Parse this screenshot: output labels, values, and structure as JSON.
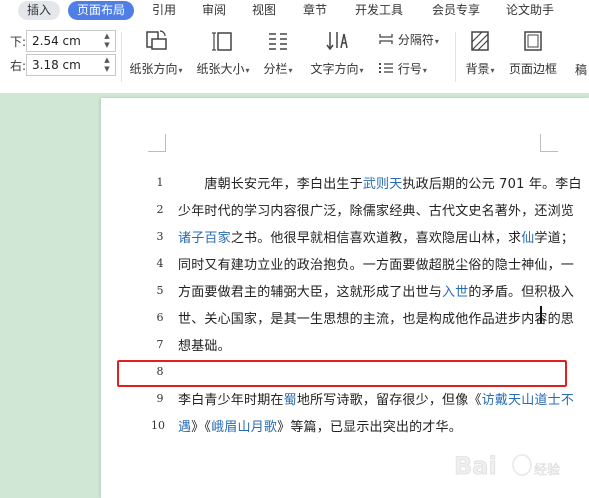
{
  "ribbon": {
    "tabs": [
      {
        "label": "插入",
        "state": "pill"
      },
      {
        "label": "页面布局",
        "state": "active"
      },
      {
        "label": "引用",
        "state": ""
      },
      {
        "label": "审阅",
        "state": ""
      },
      {
        "label": "视图",
        "state": ""
      },
      {
        "label": "章节",
        "state": ""
      },
      {
        "label": "开发工具",
        "state": ""
      },
      {
        "label": "会员专享",
        "state": ""
      },
      {
        "label": "论文助手",
        "state": ""
      }
    ],
    "margins": {
      "bottom_label": "下:",
      "bottom_value": "2.54 cm",
      "right_label": "右:",
      "right_value": "3.18 cm"
    },
    "tools": {
      "orientation": "纸张方向",
      "paper_size": "纸张大小",
      "columns": "分栏",
      "text_direction": "文字方向",
      "separator": "分隔符",
      "line_numbers": "行号",
      "background": "背景",
      "page_border": "页面边框",
      "truncated": "稿"
    }
  },
  "document": {
    "lines": [
      {
        "number": "1",
        "parts": [
          {
            "t": "　　唐朝长安元年，李白出生于"
          },
          {
            "t": "武则天",
            "link": true
          },
          {
            "t": "执政后期的公元 701 年。李白"
          }
        ]
      },
      {
        "number": "2",
        "parts": [
          {
            "t": "少年时代的学习内容很广泛，除儒家经典、古代文史名著外，还浏览"
          }
        ]
      },
      {
        "number": "3",
        "parts": [
          {
            "t": "诸子百家",
            "link": true
          },
          {
            "t": "之书。他很早就相信喜欢道教，喜欢隐居山林，求"
          },
          {
            "t": "仙",
            "link": true
          },
          {
            "t": "学道；"
          }
        ]
      },
      {
        "number": "4",
        "parts": [
          {
            "t": "同时又有建功立业的政治抱负。一方面要做超脱尘俗的隐士神仙，一"
          }
        ]
      },
      {
        "number": "5",
        "parts": [
          {
            "t": "方面要做君主的辅弼大臣，这就形成了出世与"
          },
          {
            "t": "入世",
            "link": true
          },
          {
            "t": "的矛盾。但积极入"
          }
        ]
      },
      {
        "number": "6",
        "parts": [
          {
            "t": "世、关心国家，是其一生思想的主流，也是构成他作品进步内容的思"
          }
        ]
      },
      {
        "number": "7",
        "parts": [
          {
            "t": "想基础。"
          }
        ]
      },
      {
        "number": "8",
        "parts": []
      },
      {
        "number": "9",
        "parts": [
          {
            "t": "李白青少年时期在"
          },
          {
            "t": "蜀",
            "link": true
          },
          {
            "t": "地所写诗歌，留存很少，但像《"
          },
          {
            "t": "访戴天山道士不",
            "link": true
          }
        ]
      },
      {
        "number": "10",
        "parts": [
          {
            "t": "遇",
            "link": true
          },
          {
            "t": "》《"
          },
          {
            "t": "峨眉山月歌",
            "link": true
          },
          {
            "t": "》等篇，已显示出突出的才华。"
          }
        ]
      }
    ]
  },
  "watermark": "Baidu 经验",
  "colors": {
    "accent": "#4e7ee6",
    "link": "#2a6cb3",
    "highlight": "#e02020",
    "background": "#cfe7d4"
  }
}
